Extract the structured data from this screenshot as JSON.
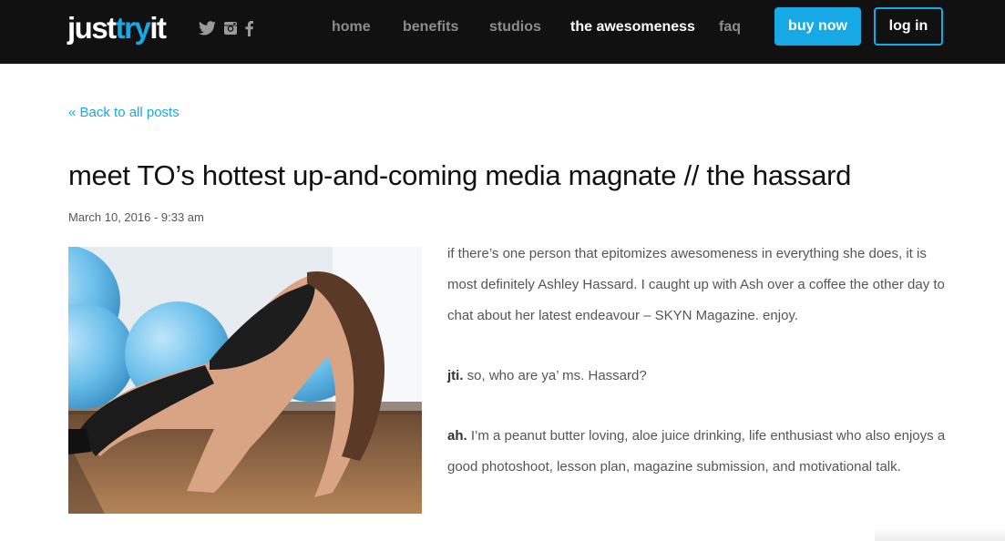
{
  "brand": {
    "logo_prefix": "just",
    "logo_accent": "try",
    "logo_suffix": "it"
  },
  "social": [
    "twitter-icon",
    "instagram-icon",
    "facebook-icon"
  ],
  "nav": {
    "items": [
      "home",
      "benefits",
      "studios",
      "the awesomeness",
      "faq"
    ],
    "active": "the awesomeness",
    "buy_label": "buy now",
    "login_label": "log in"
  },
  "post": {
    "back_link": "« Back to all posts",
    "title": "meet TO’s hottest up-and-coming media magnate // the hassard",
    "date": "March 10, 2016 - 9:33 am",
    "intro": "if there’s one person that epitomizes awesomeness in everything she does, it is most definitely Ashley Hassard. I caught up with Ash over a coffee the other day to chat about her latest endeavour – SKYN Magazine. enjoy.",
    "q1_speaker": "jti.",
    "q1_text": " so, who are ya’ ms. Hassard?",
    "a1_speaker": "ah.",
    "a1_text": " I’m a peanut butter loving, aloe juice drinking, life enthusiast who also enjoys a good photoshoot, lesson plan, magazine submission, and motivational talk."
  },
  "colors": {
    "accent": "#17a9e5",
    "header_bg": "#111111"
  }
}
